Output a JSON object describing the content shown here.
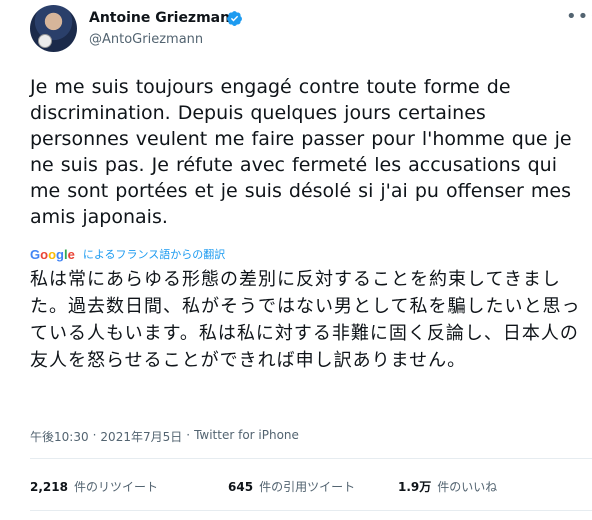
{
  "header": {
    "name": "Antoine Griezmann",
    "handle": "@AntoGriezmann",
    "more_icon": "more-dots-icon"
  },
  "tweet": {
    "text": "Je me suis toujours engagé contre toute forme de discrimination. Depuis quelques jours certaines personnes veulent me faire passer pour l'homme que je ne suis pas. Je réfute avec fermeté les accusations qui me sont portées et je suis désolé si j'ai pu offenser mes amis japonais."
  },
  "translation": {
    "label": "によるフランス語からの翻訳",
    "text": "私は常にあらゆる形態の差別に反対することを約束してきました。過去数日間、私がそうではない男として私を騙したいと思っている人もいます。私は私に対する非難に固く反論し、日本人の友人を怒らせることができれば申し訳ありません。"
  },
  "meta": {
    "time": "午後10:30",
    "date": "2021年7月5日",
    "separator": "·",
    "source": "Twitter for iPhone"
  },
  "stats": {
    "retweets_count": "2,218",
    "retweets_label": "件のリツイート",
    "quotes_count": "645",
    "quotes_label": "件の引用ツイート",
    "likes_count": "1.9万",
    "likes_label": "件のいいね"
  },
  "colors": {
    "text": "#0f1419",
    "secondary": "#536471",
    "link": "#1d9bf0",
    "verified": "#1d9bf0"
  }
}
